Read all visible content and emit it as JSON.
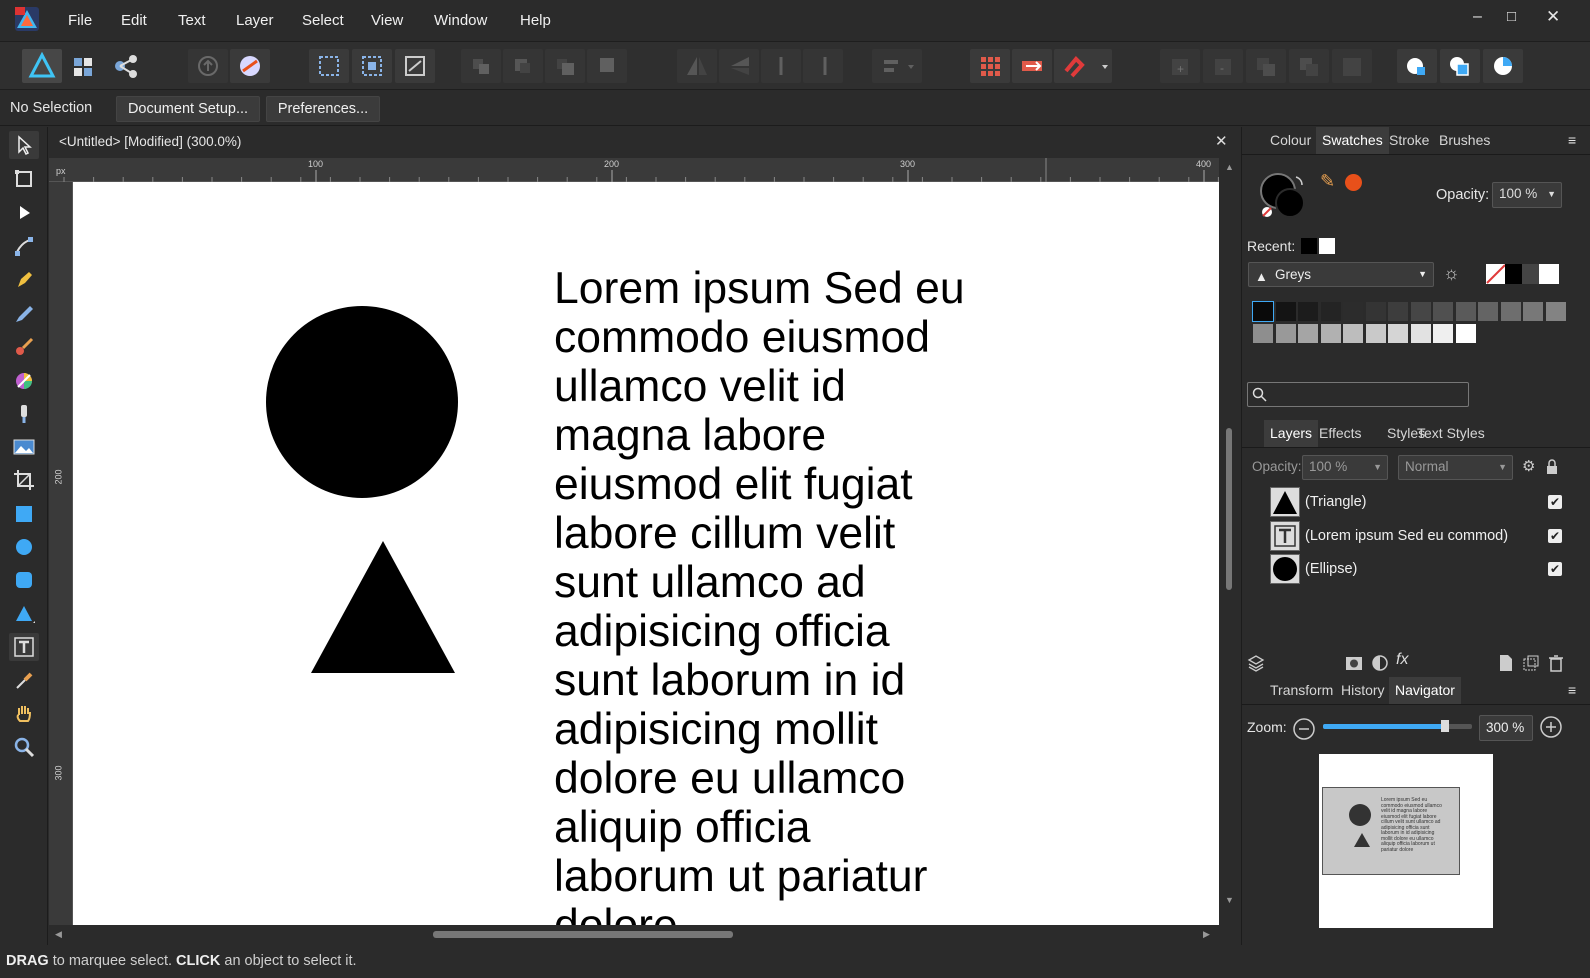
{
  "menubar": {
    "items": [
      "File",
      "Edit",
      "Text",
      "Layer",
      "Select",
      "View",
      "Window",
      "Help"
    ]
  },
  "context": {
    "selection": "No Selection",
    "doc_setup": "Document Setup...",
    "preferences": "Preferences..."
  },
  "document": {
    "tab_title": "<Untitled> [Modified] (300.0%)",
    "ruler_unit": "px",
    "ruler_h": [
      "100",
      "200",
      "300",
      "400"
    ],
    "ruler_v": [
      "200",
      "300"
    ],
    "text": "Lorem ipsum Sed eu\ncommodo eiusmod\nullamco velit id\nmagna labore\neiusmod elit fugiat\nlabore cillum velit\nsunt ullamco ad\nadipisicing officia\nsunt laborum in id\nadipisicing mollit\ndolore eu ullamco\naliquip officia\nlaborum ut pariatur\ndolore"
  },
  "status": {
    "drag": "DRAG",
    "drag_text": " to marquee select. ",
    "click": "CLICK",
    "click_text": " an object to select it."
  },
  "panels": {
    "top_tabs": [
      "Colour",
      "Swatches",
      "Stroke",
      "Brushes"
    ],
    "top_active": "Swatches",
    "opacity_label": "Opacity:",
    "opacity_value": "100 %",
    "recent_label": "Recent:",
    "palette": "Greys",
    "layers_tabs": [
      "Layers",
      "Effects",
      "Styles",
      "Text Styles"
    ],
    "layers_active": "Layers",
    "layer_opacity_label": "Opacity:",
    "layer_opacity": "100 %",
    "blend_mode": "Normal",
    "layers": [
      "(Triangle)",
      "(Lorem ipsum Sed eu commod)",
      "(Ellipse)"
    ],
    "bottom_tabs": [
      "Transform",
      "History",
      "Navigator"
    ],
    "bottom_active": "Navigator",
    "zoom_label": "Zoom:",
    "zoom_value": "300 %",
    "zoom_fraction": 0.82,
    "nav_text": "Lorem ipsum Sed eu commodo eiusmod ullamco velit id magna labore eiusmod elit fugiat labore cillum velit sunt ullamco ad adipisicing officia sunt laborum in id adipisicing mollit dolore eu ullamco aliquip officia laborum ut pariatur dolore"
  },
  "colors": {
    "accent": "#3fa9f5",
    "orange": "#e8501a",
    "greys": [
      "#0a0a0a",
      "#141414",
      "#1c1c1c",
      "#242424",
      "#2c2c2c",
      "#343434",
      "#3d3d3d",
      "#464646",
      "#505050",
      "#5a5a5a",
      "#646464",
      "#6e6e6e",
      "#787878",
      "#838383",
      "#8e8e8e",
      "#999999",
      "#a5a5a5",
      "#b1b1b1",
      "#bdbdbd",
      "#c9c9c9",
      "#d5d5d5",
      "#e2e2e2",
      "#efefef",
      "#ffffff"
    ]
  }
}
